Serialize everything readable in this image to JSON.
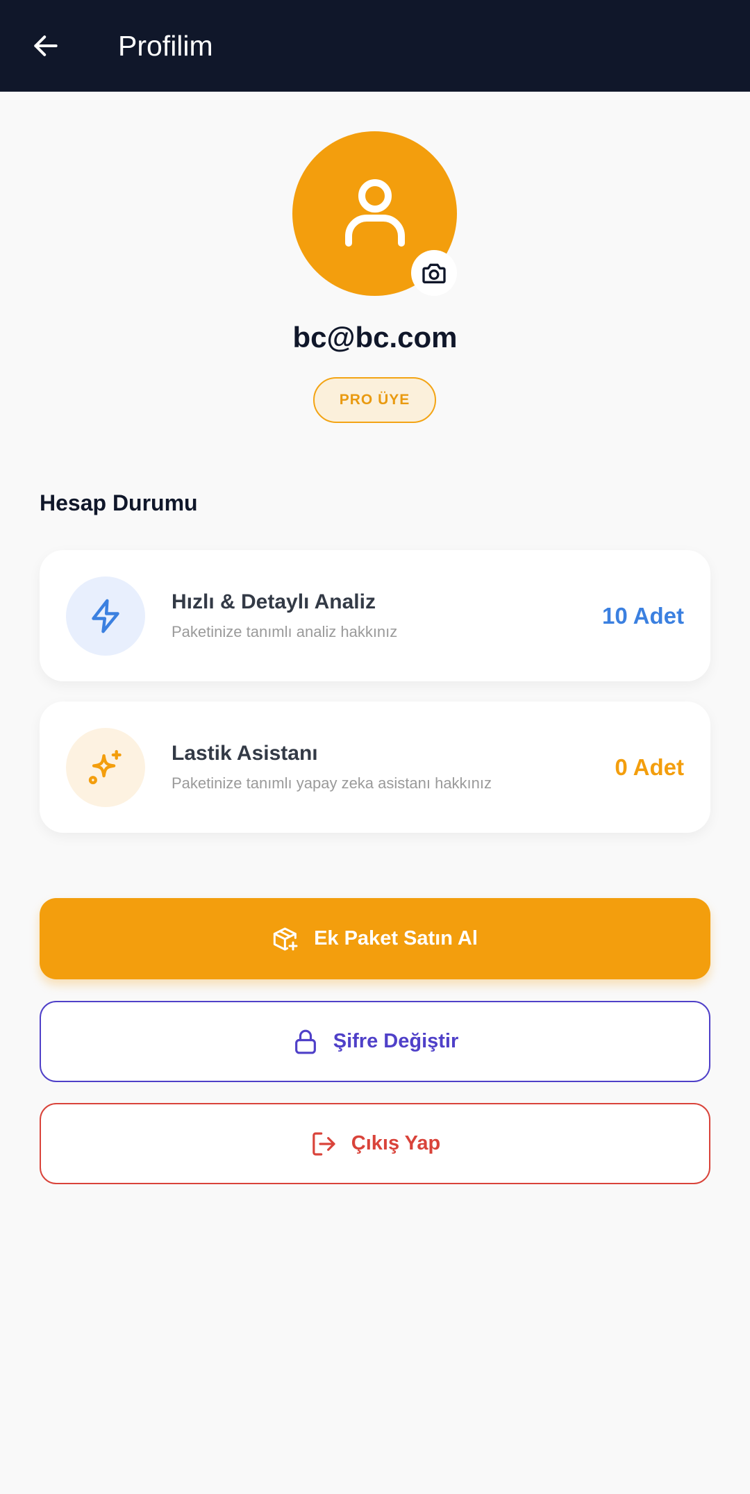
{
  "app_bar": {
    "title": "Profilim",
    "background": "#10172a",
    "back_icon": "arrow-left-icon"
  },
  "profile": {
    "avatar_icon": "user-icon",
    "avatar_color": "#f39e0d",
    "camera_icon": "camera-icon",
    "email": "bc@bc.com",
    "membership_badge": "PRO ÜYE"
  },
  "account_status": {
    "section_title": "Hesap Durumu",
    "items": [
      {
        "icon": "lightning-icon",
        "title": "Hızlı & Detaylı Analiz",
        "subtitle": "Paketinize tanımlı analiz hakkınız",
        "count": "10 Adet",
        "accent": "#3b80e0"
      },
      {
        "icon": "sparkle-icon",
        "title": "Lastik Asistanı",
        "subtitle": "Paketinize tanımlı yapay zeka asistanı hakkınız",
        "count": "0 Adet",
        "accent": "#f39e0d"
      }
    ]
  },
  "actions": {
    "buy_package": {
      "label": "Ek Paket Satın Al",
      "icon": "package-plus-icon",
      "color": "#f39e0d"
    },
    "change_password": {
      "label": "Şifre Değiştir",
      "icon": "lock-icon",
      "color": "#4f40c8"
    },
    "logout": {
      "label": "Çıkış Yap",
      "icon": "logout-icon",
      "color": "#d9433a"
    }
  }
}
